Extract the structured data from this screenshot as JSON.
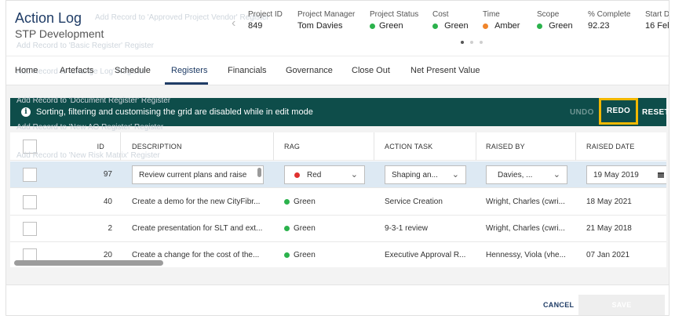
{
  "header": {
    "title": "Action Log",
    "subtitle": "STP Development",
    "ghost_links": [
      "Add Record to 'Approved Project Vendor' Register",
      "Add Record to 'Basic Register' Register",
      "Add Record to 'Change Log' Register",
      "Add Record to 'Document Register' Register",
      "Add Record to 'New AO Register' Register",
      "Add Record to 'New Risk Matrix' Register"
    ],
    "meta": [
      {
        "label": "Project ID",
        "value": "849",
        "status": ""
      },
      {
        "label": "Project Manager",
        "value": "Tom Davies",
        "status": ""
      },
      {
        "label": "Project Status",
        "value": "Green",
        "status": "green"
      },
      {
        "label": "Cost",
        "value": "Green",
        "status": "green"
      },
      {
        "label": "Time",
        "value": "Amber",
        "status": "amber"
      },
      {
        "label": "Scope",
        "value": "Green",
        "status": "green"
      },
      {
        "label": "% Complete",
        "value": "92.23",
        "status": ""
      },
      {
        "label": "Start D",
        "value": "16 Fel",
        "status": ""
      }
    ]
  },
  "tabs": [
    "Home",
    "Artefacts",
    "Schedule",
    "Registers",
    "Financials",
    "Governance",
    "Close Out",
    "Net Present Value"
  ],
  "active_tab": "Registers",
  "banner": {
    "message": "Sorting, filtering and customising the grid are disabled while in edit mode",
    "undo": "UNDO",
    "redo": "REDO",
    "reset": "RESET"
  },
  "grid": {
    "columns": [
      "ID",
      "DESCRIPTION",
      "RAG",
      "ACTION TASK",
      "RAISED BY",
      "RAISED DATE"
    ],
    "edit_row": {
      "id": "97",
      "description": "Review current plans and raise",
      "rag": "Red",
      "action_task": "Shaping an...",
      "raised_by": "Davies, ...",
      "raised_date": "19 May 2019"
    },
    "rows": [
      {
        "id": "40",
        "description": "Create a demo for the new CityFibr...",
        "rag": "Green",
        "action_task": "Service Creation",
        "raised_by": "Wright, Charles (cwri...",
        "raised_date": "18 May 2021"
      },
      {
        "id": "2",
        "description": "Create presentation for SLT and ext...",
        "rag": "Green",
        "action_task": "9-3-1 review",
        "raised_by": "Wright, Charles (cwri...",
        "raised_date": "21 May 2018"
      },
      {
        "id": "20",
        "description": "Create a change for the cost of the...",
        "rag": "Green",
        "action_task": "Executive Approval R...",
        "raised_by": "Hennessy, Viola (vhe...",
        "raised_date": "07 Jan 2021"
      }
    ]
  },
  "footer": {
    "cancel": "CANCEL",
    "save": "SAVE"
  },
  "colors": {
    "primary": "#1f3c66",
    "banner": "#0e4d4a",
    "highlight": "#f2b800",
    "green": "#2bb24c",
    "amber": "#f0852b",
    "red": "#e0312f",
    "edit_row": "#dde9f3"
  }
}
